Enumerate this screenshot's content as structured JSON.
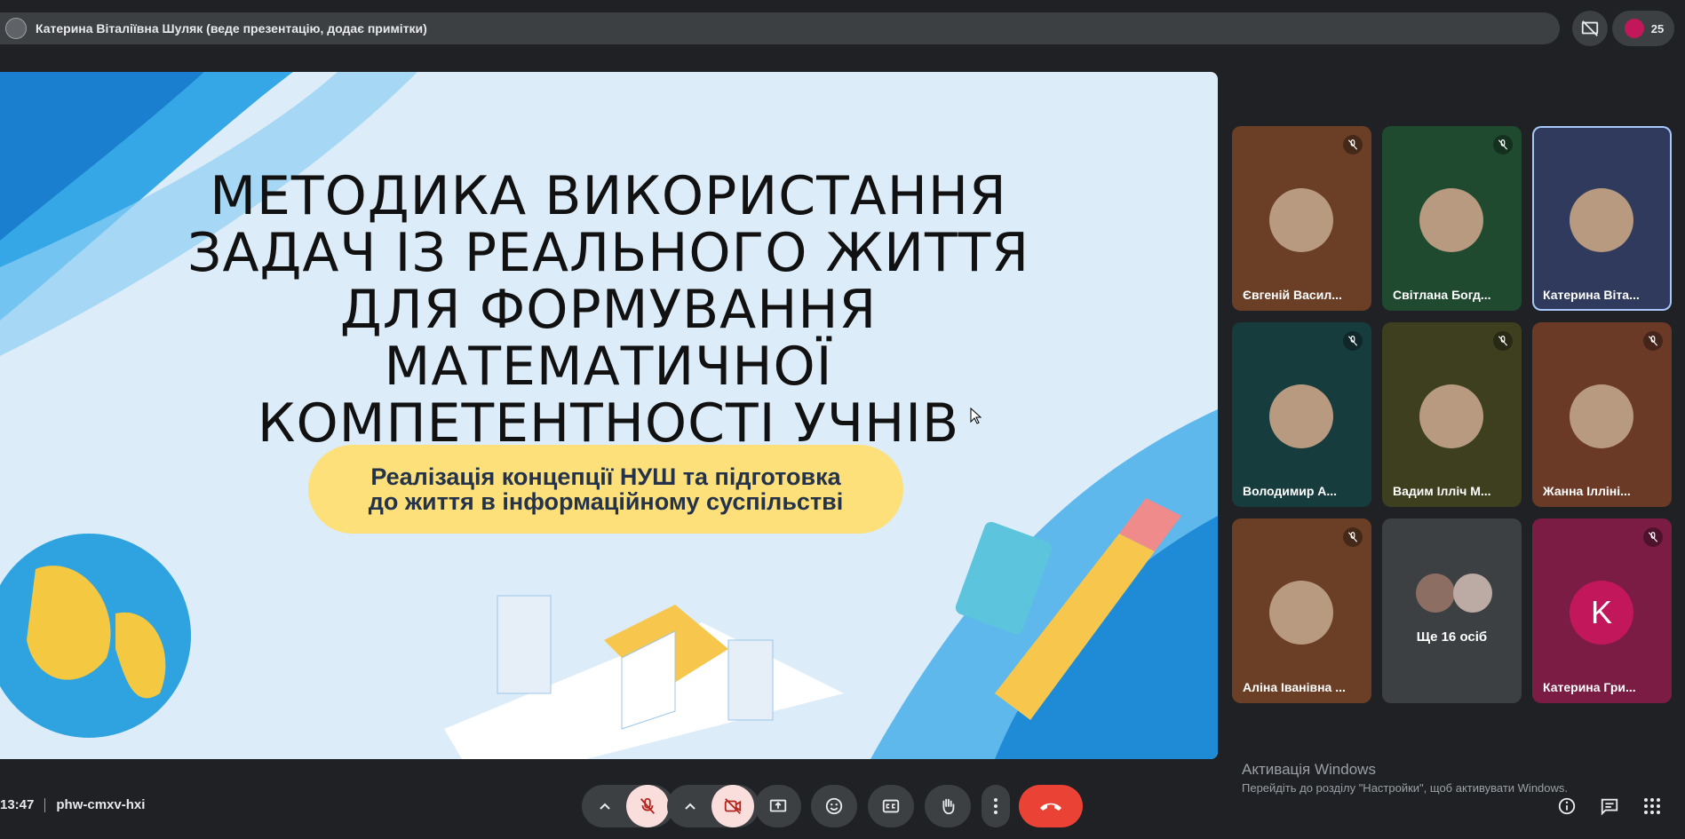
{
  "presenter_bar": {
    "title": "Катерина Віталіївна Шуляк (веде презентацію, додає примітки)",
    "participant_count": "25"
  },
  "slide": {
    "title_lines": [
      "МЕТОДИКА ВИКОРИСТАННЯ",
      "ЗАДАЧ ІЗ РЕАЛЬНОГО ЖИТТЯ",
      "ДЛЯ ФОРМУВАННЯ",
      "МАТЕМАТИЧНОЇ",
      "КОМПЕТЕНТНОСТІ УЧНІВ"
    ],
    "subtitle_lines": [
      "Реалізація концепції НУШ та підготовка",
      "до життя в інформаційному суспільстві"
    ]
  },
  "participants": [
    {
      "name": "Євгеній Васил...",
      "bg": "#6a3f26",
      "muted": true
    },
    {
      "name": "Світлана Богд...",
      "bg": "#1f4a30",
      "muted": true
    },
    {
      "name": "Катерина Віта...",
      "bg": "#2f3a5c",
      "muted": false,
      "speaking": true
    },
    {
      "name": "Володимир А...",
      "bg": "#173c3e",
      "muted": true
    },
    {
      "name": "Вадим Ілліч М...",
      "bg": "#3d3f1f",
      "muted": true
    },
    {
      "name": "Жанна Ілліні...",
      "bg": "#6b3a27",
      "muted": true
    },
    {
      "name": "Аліна Іванівна ...",
      "bg": "#6a3f26",
      "muted": true
    },
    {
      "name": "Ще 16 осіб",
      "bg": "#3c4043",
      "muted": false
    },
    {
      "name": "Катерина Гри...",
      "bg": "#7a1c44",
      "muted": true,
      "initial": "K"
    }
  ],
  "activation": {
    "title": "Активація Windows",
    "text": "Перейдіть до розділу \"Настройки\", щоб активувати Windows."
  },
  "meeting": {
    "time": "13:47",
    "code": "phw-cmxv-hxi"
  },
  "colors": {
    "background": "#202124",
    "bar": "#3c4043",
    "end_call": "#ea4335",
    "muted_control": "#f9dedc"
  }
}
